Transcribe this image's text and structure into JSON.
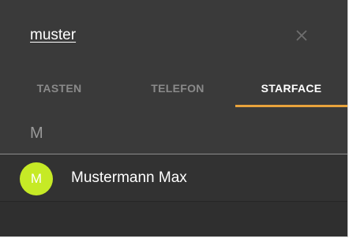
{
  "search": {
    "query": "muster"
  },
  "tabs": [
    {
      "label": "TASTEN"
    },
    {
      "label": "TELEFON"
    },
    {
      "label": "STARFACE"
    }
  ],
  "colors": {
    "active_tab_indicator": "#e8a33c",
    "avatar_background": "#c6ea26"
  },
  "results": {
    "section_letter": "M",
    "contacts": [
      {
        "initial": "M",
        "name": "Mustermann Max"
      }
    ]
  }
}
